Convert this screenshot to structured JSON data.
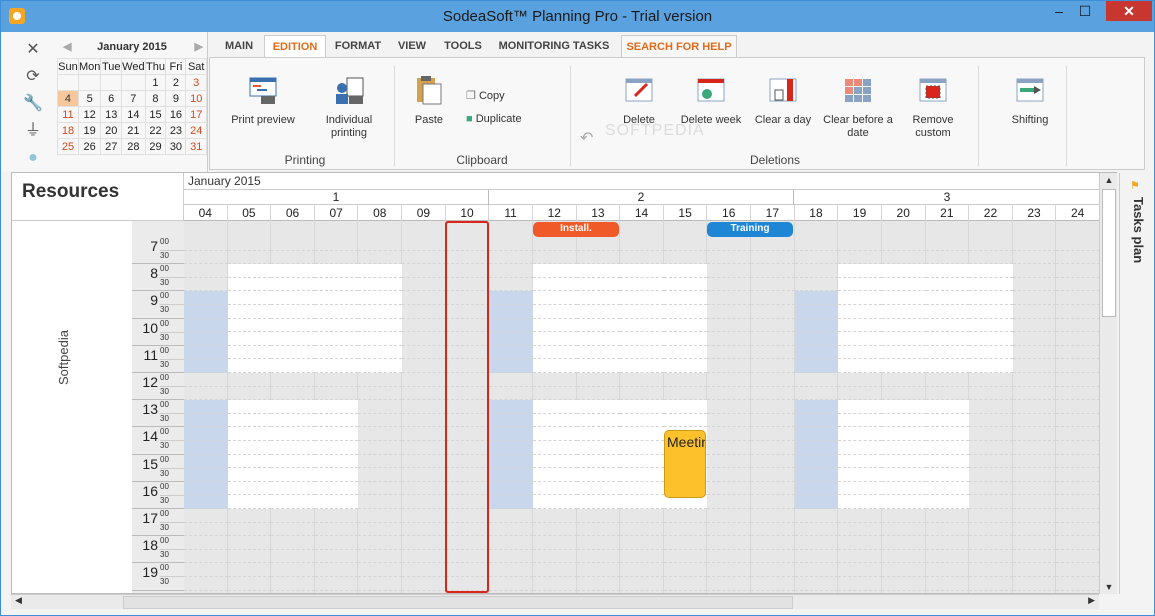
{
  "window": {
    "title": "SodeaSoft™ Planning Pro - Trial version",
    "min": "–",
    "max": "☐",
    "close": "✕"
  },
  "calendar": {
    "month": "January 2015",
    "prev": "◀",
    "next": "▶",
    "weekdays": [
      "Sun",
      "Mon",
      "Tue",
      "Wed",
      "Thu",
      "Fri",
      "Sat"
    ],
    "weeks": [
      [
        "",
        "",
        "",
        "",
        "1",
        "2",
        "3"
      ],
      [
        "4",
        "5",
        "6",
        "7",
        "8",
        "9",
        "10"
      ],
      [
        "11",
        "12",
        "13",
        "14",
        "15",
        "16",
        "17"
      ],
      [
        "18",
        "19",
        "20",
        "21",
        "22",
        "23",
        "24"
      ],
      [
        "25",
        "26",
        "27",
        "28",
        "29",
        "30",
        "31"
      ]
    ],
    "today": "4"
  },
  "tabs": [
    "MAIN",
    "EDITION",
    "FORMAT",
    "VIEW",
    "TOOLS",
    "MONITORING TASKS",
    "SEARCH FOR HELP"
  ],
  "active_tab": "EDITION",
  "ribbon": {
    "printing": {
      "label": "Printing",
      "print_preview": "Print preview",
      "individual_printing": "Individual printing"
    },
    "clipboard": {
      "label": "Clipboard",
      "paste": "Paste",
      "copy": "Copy",
      "duplicate": "Duplicate"
    },
    "deletions": {
      "label": "Deletions",
      "delete": "Delete",
      "delete_week": "Delete week",
      "clear_day": "Clear a day",
      "clear_before": "Clear before a date",
      "remove_custom": "Remove custom"
    },
    "shifting": "Shifting",
    "watermark": "SOFTPEDIA"
  },
  "planner": {
    "resources_title": "Resources",
    "resource": "Softpedia",
    "month": "January 2015",
    "weeks": [
      "1",
      "2",
      "3"
    ],
    "days": [
      "04",
      "05",
      "06",
      "07",
      "08",
      "09",
      "10",
      "11",
      "12",
      "13",
      "14",
      "15",
      "16",
      "17",
      "18",
      "19",
      "20",
      "21",
      "22",
      "23",
      "24"
    ],
    "hours": [
      "7",
      "8",
      "9",
      "10",
      "11",
      "12",
      "13",
      "14",
      "15",
      "16",
      "17",
      "18",
      "19"
    ],
    "min00": "00",
    "min30": "30",
    "tasks": [
      {
        "label": "Install.",
        "color": "#f05a28"
      },
      {
        "label": "Training",
        "color": "#1f86d6"
      }
    ],
    "meeting": "Meeting"
  },
  "tasks_plan": "Tasks plan"
}
